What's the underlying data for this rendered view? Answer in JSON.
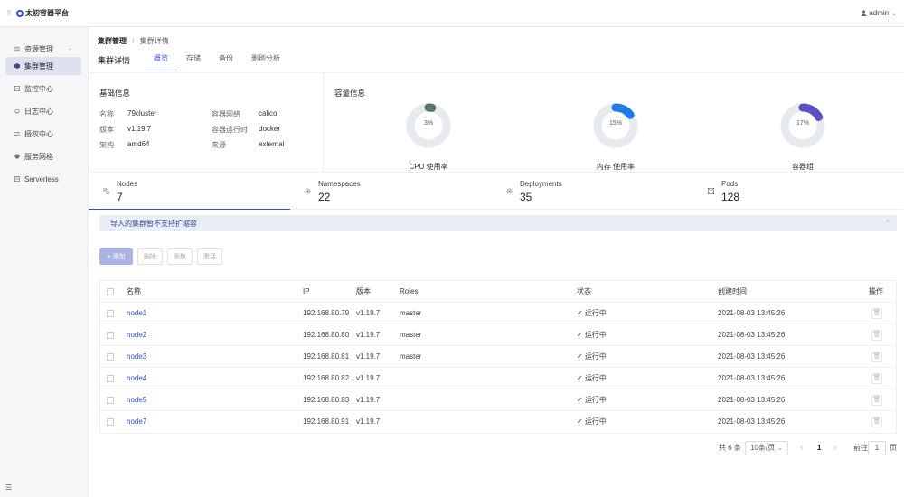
{
  "app": {
    "title": "太初容器平台",
    "user": "admin"
  },
  "sidebar": {
    "items": [
      {
        "label": "资源管理",
        "icon": "sliders-icon"
      },
      {
        "label": "集群管理",
        "icon": "cube-icon"
      },
      {
        "label": "监控中心",
        "icon": "monitor-icon"
      },
      {
        "label": "日志中心",
        "icon": "bell-icon"
      },
      {
        "label": "授权中心",
        "icon": "swap-icon"
      },
      {
        "label": "服务网格",
        "icon": "mesh-icon"
      },
      {
        "label": "Serverless",
        "icon": "document-icon"
      }
    ]
  },
  "breadcrumb": {
    "parent": "集群管理",
    "sep": "/",
    "current": "集群详情"
  },
  "page": {
    "title": "集群详情",
    "tabs": [
      "概览",
      "存储",
      "备份",
      "删刷分析"
    ]
  },
  "basic": {
    "title": "基础信息",
    "fields": [
      {
        "label": "名称",
        "value": "79cluster"
      },
      {
        "label": "容器网络",
        "value": "calico"
      },
      {
        "label": "版本",
        "value": "v1.19.7"
      },
      {
        "label": "容器运行时",
        "value": "docker"
      },
      {
        "label": "架构",
        "value": "amd64"
      },
      {
        "label": "来源",
        "value": "external"
      }
    ]
  },
  "capacity": {
    "title": "容量信息",
    "gauges": [
      {
        "label": "CPU 使用率",
        "pct_text": "3%",
        "value": 0.03,
        "color": "#5b7567"
      },
      {
        "label": "内存 使用率",
        "pct_text": "15%",
        "value": 0.15,
        "color": "#1e7be8"
      },
      {
        "label": "容器组",
        "pct_text": "17%",
        "value": 0.17,
        "color": "#5a52c2"
      }
    ]
  },
  "stats": [
    {
      "name": "Nodes",
      "value": "7",
      "icon": "nodes-icon"
    },
    {
      "name": "Namespaces",
      "value": "22",
      "icon": "gear-icon"
    },
    {
      "name": "Deployments",
      "value": "35",
      "icon": "gear-icon"
    },
    {
      "name": "Pods",
      "value": "128",
      "icon": "pods-icon"
    }
  ],
  "alert": {
    "text": "导入的集群暂不支持扩缩容",
    "close": "×"
  },
  "actions": {
    "add": "+ 添加",
    "delete": "删除",
    "evict": "驱散",
    "activate": "激活"
  },
  "table": {
    "headers": [
      "名称",
      "IP",
      "版本",
      "Roles",
      "状态",
      "创建时间",
      "操作"
    ],
    "rows": [
      {
        "name": "node1",
        "ip": "192.168.80.79",
        "version": "v1.19.7",
        "roles": "master",
        "status": "运行中",
        "created": "2021-08-03 13:45:26"
      },
      {
        "name": "node2",
        "ip": "192.168.80.80",
        "version": "v1.19.7",
        "roles": "master",
        "status": "运行中",
        "created": "2021-08-03 13:45:26"
      },
      {
        "name": "node3",
        "ip": "192.168.80.81",
        "version": "v1.19.7",
        "roles": "master",
        "status": "运行中",
        "created": "2021-08-03 13:45:26"
      },
      {
        "name": "node4",
        "ip": "192.168.80.82",
        "version": "v1.19.7",
        "roles": "",
        "status": "运行中",
        "created": "2021-08-03 13:45:26"
      },
      {
        "name": "node5",
        "ip": "192.168.80.83",
        "version": "v1.19.7",
        "roles": "",
        "status": "运行中",
        "created": "2021-08-03 13:45:26"
      },
      {
        "name": "node7",
        "ip": "192.168.80.91",
        "version": "v1.19.7",
        "roles": "",
        "status": "运行中",
        "created": "2021-08-03 13:45:26"
      }
    ]
  },
  "pagination": {
    "total": "共 6 条",
    "page_size": "10条/页",
    "prev": "‹",
    "current": "1",
    "next": "›",
    "goto_label": "前往",
    "goto_value": "1",
    "goto_suffix": "页"
  }
}
